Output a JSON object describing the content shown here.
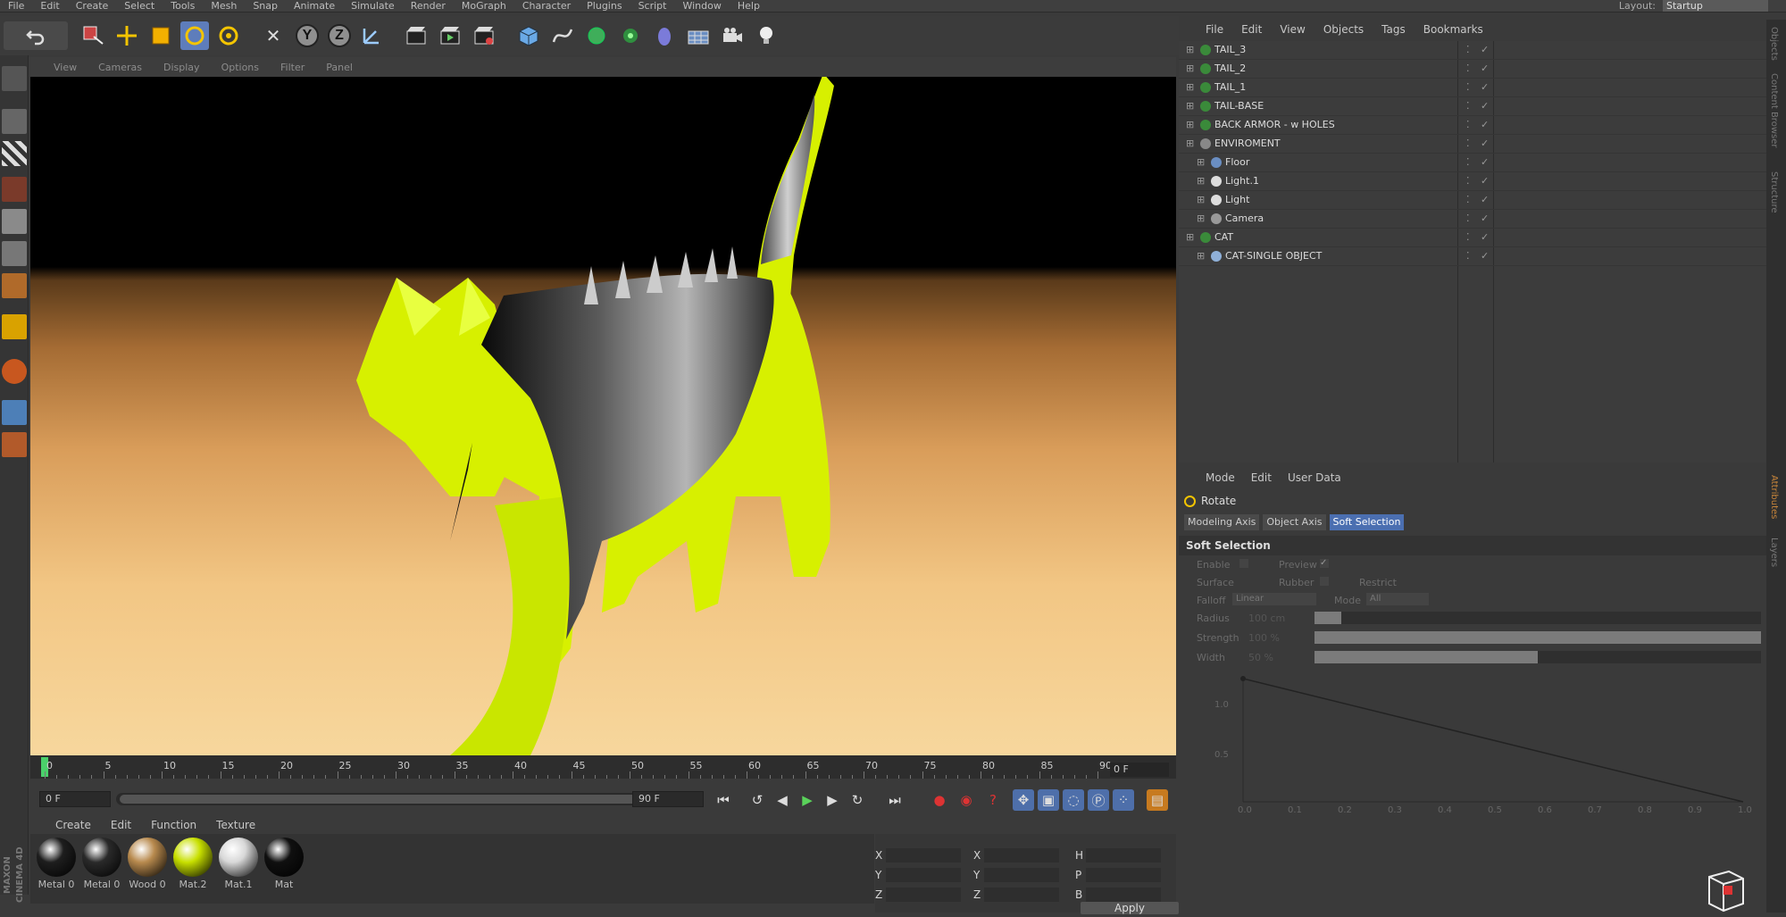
{
  "menubar": {
    "items": [
      "File",
      "Edit",
      "Create",
      "Select",
      "Tools",
      "Mesh",
      "Snap",
      "Animate",
      "Simulate",
      "Render",
      "MoGraph",
      "Character",
      "Plugins",
      "Script",
      "Window",
      "Help"
    ],
    "layout_label": "Layout:",
    "layout_value": "Startup"
  },
  "toolbar": {
    "axis_x": "X",
    "axis_y": "Y",
    "axis_z": "Z"
  },
  "viewport": {
    "menu": [
      "View",
      "Cameras",
      "Display",
      "Options",
      "Filter",
      "Panel"
    ]
  },
  "timeline": {
    "ticks": [
      "0",
      "5",
      "10",
      "15",
      "20",
      "25",
      "30",
      "35",
      "40",
      "45",
      "50",
      "55",
      "60",
      "65",
      "70",
      "75",
      "80",
      "85",
      "90"
    ],
    "current_frame": "0 F",
    "start_field": "0 F",
    "end_field": "90 F"
  },
  "materials": {
    "menu": [
      "Create",
      "Edit",
      "Function",
      "Texture"
    ],
    "items": [
      {
        "label": "Metal 0",
        "color": "#1e1e1e"
      },
      {
        "label": "Metal 0",
        "color": "#2a2a2a"
      },
      {
        "label": "Wood 0",
        "color": "#b88a4e"
      },
      {
        "label": "Mat.2",
        "color": "#c8e000"
      },
      {
        "label": "Mat.1",
        "color": "#d8d8d8"
      },
      {
        "label": "Mat",
        "color": "#101010"
      }
    ],
    "logo": "MAXON CINEMA 4D"
  },
  "coordinates": {
    "rows": [
      {
        "a": "X",
        "b": "X",
        "c": "H"
      },
      {
        "a": "Y",
        "b": "Y",
        "c": "P"
      },
      {
        "a": "Z",
        "b": "Z",
        "c": "B"
      }
    ],
    "apply": "Apply"
  },
  "objects": {
    "menu": [
      "File",
      "Edit",
      "View",
      "Objects",
      "Tags",
      "Bookmarks"
    ],
    "items": [
      {
        "name": "TAIL_3",
        "indent": 0,
        "icon": "#3a8a3a"
      },
      {
        "name": "TAIL_2",
        "indent": 0,
        "icon": "#3a8a3a"
      },
      {
        "name": "TAIL_1",
        "indent": 0,
        "icon": "#3a8a3a"
      },
      {
        "name": "TAIL-BASE",
        "indent": 0,
        "icon": "#3a8a3a"
      },
      {
        "name": "BACK ARMOR - w HOLES",
        "indent": 0,
        "icon": "#3a8a3a"
      },
      {
        "name": "ENVIROMENT",
        "indent": 0,
        "icon": "#888888"
      },
      {
        "name": "Floor",
        "indent": 1,
        "icon": "#6a8ec2"
      },
      {
        "name": "Light.1",
        "indent": 1,
        "icon": "#dddddd"
      },
      {
        "name": "Light",
        "indent": 1,
        "icon": "#dddddd"
      },
      {
        "name": "Camera",
        "indent": 1,
        "icon": "#999999"
      },
      {
        "name": "CAT",
        "indent": 0,
        "icon": "#3a8a3a"
      },
      {
        "name": "CAT-SINGLE OBJECT",
        "indent": 1,
        "icon": "#8fb0d8"
      }
    ]
  },
  "attributes": {
    "menu": [
      "Mode",
      "Edit",
      "User Data"
    ],
    "title": "Rotate",
    "tabs": [
      "Modeling Axis",
      "Object Axis",
      "Soft Selection"
    ],
    "section": "Soft Selection",
    "params": {
      "enable": "Enable",
      "preview": "Preview",
      "surface": "Surface",
      "rubber": "Rubber",
      "restrict": "Restrict",
      "falloff": "Falloff",
      "falloff_value": "Linear",
      "mode": "Mode",
      "mode_value": "All",
      "radius": "Radius",
      "radius_value": "100 cm",
      "strength": "Strength",
      "strength_value": "100 %",
      "width": "Width",
      "width_value": "50 %"
    },
    "radius_level": 0.06,
    "strength_level": 1.0,
    "width_level": 0.5,
    "curve_x_labels": [
      "0.0",
      "0.1",
      "0.2",
      "0.3",
      "0.4",
      "0.5",
      "0.6",
      "0.7",
      "0.8",
      "0.9",
      "1.0"
    ],
    "curve_y_labels": [
      "1.0",
      "0.5"
    ]
  },
  "side_tabs": [
    "Objects",
    "Content Browser",
    "Structure",
    "Attributes",
    "Layers"
  ]
}
